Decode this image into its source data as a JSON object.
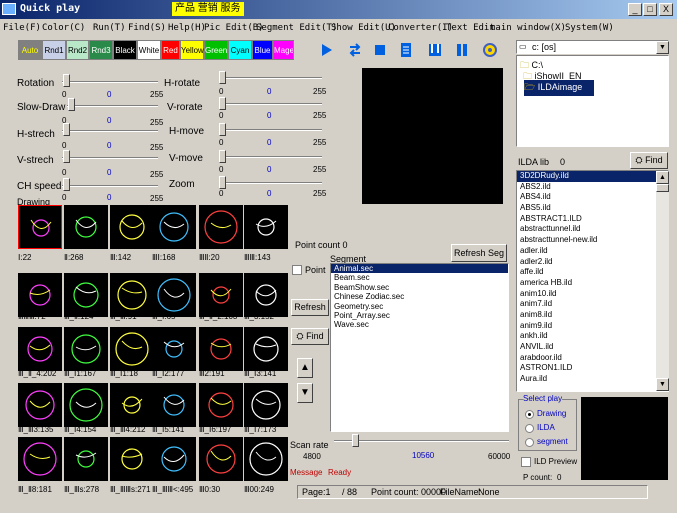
{
  "window": {
    "title": "Quick play",
    "banner": "产品 营销 服务",
    "minimize": "_",
    "maximize": "□",
    "close": "X"
  },
  "menu": [
    "File(F)",
    "Color(C)",
    "Run(T)",
    "Find(S)",
    "Help(H)",
    "Pic Edit(B)",
    "Segment Edit(T)",
    "Show Edit(U)",
    "Converter(I)",
    "Text Edit",
    "main window(X)",
    "System(W)"
  ],
  "colors": [
    {
      "label": "Auto",
      "bg": "#808080",
      "fg": "#ffff00"
    },
    {
      "label": "Rnd1",
      "bg": "#c8d0e8",
      "fg": "#000000"
    },
    {
      "label": "Rnd2",
      "bg": "#b8e8c8",
      "fg": "#000000"
    },
    {
      "label": "Rnd3",
      "bg": "#2a8a4a",
      "fg": "#ffffff"
    },
    {
      "label": "Black",
      "bg": "#000000",
      "fg": "#ffffff"
    },
    {
      "label": "White",
      "bg": "#ffffff",
      "fg": "#000000"
    },
    {
      "label": "Red",
      "bg": "#ff0000",
      "fg": "#ffffff"
    },
    {
      "label": "Yellow",
      "bg": "#ffff00",
      "fg": "#000000"
    },
    {
      "label": "Green",
      "bg": "#00c000",
      "fg": "#ffffff"
    },
    {
      "label": "Cyan",
      "bg": "#00ffff",
      "fg": "#000000"
    },
    {
      "label": "Blue",
      "bg": "#0000ff",
      "fg": "#ffffff"
    },
    {
      "label": "Magenta",
      "bg": "#ff00ff",
      "fg": "#ffffff"
    }
  ],
  "toolbar_icons": [
    "play-icon",
    "loop-icon",
    "stop-icon",
    "list-icon",
    "frame-icon",
    "pause-icon",
    "settings-icon"
  ],
  "sliders": {
    "rotation": {
      "label": "Rotation",
      "min": "0",
      "value": "0",
      "max": "255"
    },
    "h_rotate": {
      "label": "H-rotate",
      "min": "0",
      "value": "0",
      "max": "255"
    },
    "slow_draw": {
      "label": "Slow-Draw",
      "min": "0",
      "value": "0",
      "max": "255"
    },
    "v_rorate": {
      "label": "V-rorate",
      "min": "0",
      "value": "0",
      "max": "255"
    },
    "h_strech": {
      "label": "H-strech",
      "min": "0",
      "value": "0",
      "max": "255"
    },
    "h_move": {
      "label": "H-move",
      "min": "0",
      "value": "0",
      "max": "255"
    },
    "v_strech": {
      "label": "V-strech",
      "min": "0",
      "value": "0",
      "max": "255"
    },
    "v_move": {
      "label": "V-move",
      "min": "0",
      "value": "0",
      "max": "255"
    },
    "ch_speed": {
      "label": "CH speed",
      "min": "0",
      "value": "0",
      "max": "255"
    },
    "zoom": {
      "label": "Zoom",
      "min": "0",
      "value": "0",
      "max": "255"
    }
  },
  "drawing_label": "Drawing",
  "thumbnails": [
    {
      "caption": "Ⅰ:22"
    },
    {
      "caption": "Ⅱ:268"
    },
    {
      "caption": "Ⅲ:142"
    },
    {
      "caption": "ⅢⅠ:168"
    },
    {
      "caption": "ⅢⅡ:20"
    },
    {
      "caption": "ⅢⅢ:143"
    },
    {
      "caption": "ⅢⅢⅢ:72"
    },
    {
      "caption": "Ⅲ_Ⅱ:124"
    },
    {
      "caption": "Ⅲ_Ⅲ:91"
    },
    {
      "caption": "Ⅲ_Ⅰ:65"
    },
    {
      "caption": "Ⅲ_Ⅱ_2:103"
    },
    {
      "caption": "Ⅲ_3:152"
    },
    {
      "caption": "Ⅲ_Ⅱ_4:202"
    },
    {
      "caption": "Ⅲ_Ⅰ1:167"
    },
    {
      "caption": "Ⅲ_Ⅰ1:18"
    },
    {
      "caption": "Ⅲ_Ⅰ2:177"
    },
    {
      "caption": "Ⅲ2:191"
    },
    {
      "caption": "Ⅲ_Ⅰ3:141"
    },
    {
      "caption": "Ⅲ_Ⅲ3:135"
    },
    {
      "caption": "Ⅲ_Ⅰ4:154"
    },
    {
      "caption": "Ⅲ_Ⅲ4:212"
    },
    {
      "caption": "Ⅲ_Ⅰ5:141"
    },
    {
      "caption": "Ⅲ_Ⅰ6:197"
    },
    {
      "caption": "Ⅲ_Ⅰ7:173"
    },
    {
      "caption": "Ⅲ_Ⅱ8:181"
    },
    {
      "caption": "Ⅲ_Ⅲs:278"
    },
    {
      "caption": "Ⅲ_ⅢⅢs:271"
    },
    {
      "caption": "Ⅲ_ⅢⅢ<:495"
    },
    {
      "caption": "Ⅲ0:30"
    },
    {
      "caption": "Ⅲ00:249"
    }
  ],
  "segment_panel": {
    "point_count_label": "Point count",
    "point_count": "0",
    "segment_label": "Segment",
    "refresh_seg": "Refresh Seg",
    "point_chk": "Point",
    "refresh": "Refresh",
    "find": "Find",
    "items": [
      "Animal.sec",
      "Beam.sec",
      "BeamShow.sec",
      "Chinese Zodiac.sec",
      "Geometry.sec",
      "Point_Array.sec",
      "Wave.sec"
    ]
  },
  "scan": {
    "label": "Scan rate",
    "min": "4800",
    "value": "10560",
    "max": "60000"
  },
  "message": {
    "label": "Message",
    "text": "Ready"
  },
  "status": {
    "page_label": "Page:1",
    "page_total": "/ 88",
    "point_count": "Point count: 00000",
    "file_label": "FileName:",
    "file_name": "None"
  },
  "drive": "c: [os]",
  "folders": [
    "C:\\",
    "iShowII_EN",
    "ILDAimage"
  ],
  "ilda": {
    "label": "ILDA lib",
    "count": "0",
    "find": "Find",
    "files": [
      "3D2DRudy.ild",
      "ABS2.ild",
      "ABS4.ild",
      "ABS5.ild",
      "ABSTRACT1.ILD",
      "abstracttunnel.ild",
      "abstracttunnel-new.ild",
      "adler.ild",
      "adler2.ild",
      "affe.ild",
      "america HB.ild",
      "anim10.ild",
      "anim7.ild",
      "anim8.ild",
      "anim9.ild",
      "ankh.ild",
      "ANVIL.ild",
      "arabdoor.ild",
      "ASTRON1.ILD",
      "Aura.ild"
    ]
  },
  "select_play": {
    "title": "Select play",
    "options": [
      "Drawing",
      "ILDA",
      "segment"
    ],
    "ild_preview": "ILD Preview",
    "p_count_label": "P count:",
    "p_count": "0"
  }
}
